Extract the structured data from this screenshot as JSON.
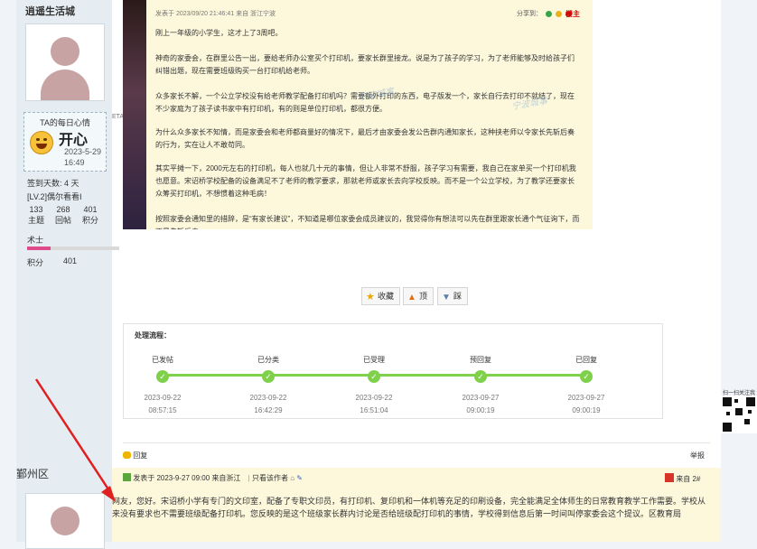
{
  "sidebar": {
    "username": "逍遥生活城",
    "mood_title": "TA的每日心情",
    "mood_text": "开心",
    "mood_date": "2023-5-29",
    "mood_time": "16:49",
    "sign_days": "签到天数: 4 天",
    "level": "[LV.2]偶尔看看I",
    "stats": [
      {
        "value": "133",
        "label": "主题"
      },
      {
        "value": "268",
        "label": "回帖"
      },
      {
        "value": "401",
        "label": "积分"
      }
    ],
    "rank": "术士",
    "points_label": "积分",
    "points_value": "401",
    "side_label": "ETA",
    "area2": "鄞州区"
  },
  "post": {
    "meta": "发表于 2023/09/20 21:46:41 来自 浙江宁波",
    "share": "分享到：",
    "floor": "楼主",
    "paragraphs": [
      "刚上一年级的小学生，这才上了3周吧。",
      "神奇的家委会，在群里公告一出，要给老师办公室买个打印机，要家长群里接龙。说是为了孩子的学习，为了老师能够及时给孩子们纠错出题，现在需要班级购买一台打印机给老师。",
      "众多家长不解，一个公立学校没有给老师教学配备打印机吗？需要额外打印的东西，电子版发一个，家长自行去打印不就结了，现在不少家庭为了孩子读书家中有打印机，有的则是单位打印机，都很方便。",
      "为什么众多家长不知情，而是家委会和老师都商量好的情况下，最后才由家委会发公告群内通知家长，这种挟老师以令家长先斩后奏的行为，实在让人不敢苟同。",
      "其实平摊一下，2000元左右的打印机，每人也就几十元的事情，但让人非常不舒服，孩子学习有需要，我自己在家单买一个打印机我也愿意。宋诏桥学校配备的设备满足不了老师的教学要求，那就老师或家长去向学校反映。而不是一个公立学校，为了教学还要家长众筹买打印机，不想惯着这种毛病！",
      "按照家委会通知里的措辞，是“有家长建议”，不知道是哪位家委会成员建议的，我觉得你有想法可以先在群里跟家长通个气征询下，而不是先斩后奏。"
    ]
  },
  "watermark": "宁波城事",
  "buttons": {
    "favorite": "收藏",
    "up": "顶",
    "down": "踩"
  },
  "flow": {
    "title": "处理流程：",
    "steps": [
      {
        "label": "已发帖",
        "date": "2023-09-22",
        "time": "08:57:15"
      },
      {
        "label": "已分类",
        "date": "2023-09-22",
        "time": "16:42:29"
      },
      {
        "label": "已受理",
        "date": "2023-09-22",
        "time": "16:51:04"
      },
      {
        "label": "预回复",
        "date": "2023-09-27",
        "time": "09:00:19"
      },
      {
        "label": "已回复",
        "date": "2023-09-27",
        "time": "09:00:19"
      }
    ]
  },
  "reply_bar": {
    "reply": "回复",
    "report": "举报"
  },
  "reply_post": {
    "meta": "发表于 2023-9-27 09:00 来自浙江",
    "only_author": "只看该作者",
    "source": "来自",
    "floor": "2#",
    "text": "网友，您好。宋诏桥小学有专门的文印室，配备了专职文印员，有打印机、复印机和一体机等充足的印刷设备，完全能满足全体师生的日常教育教学工作需要。学校从来没有要求也不需要班级配备打印机。您反映的是这个班级家长群内讨论是否给班级配打印机的事情，学校得到信息后第一时间叫停家委会这个提议。区教育局"
  },
  "qr_label": "扫一扫关注我",
  "colors": {
    "accent_green": "#7fd04a",
    "post_bg": "#fdf8dc",
    "sidebar_bg": "#e5edf2",
    "arrow_red": "#e02020"
  }
}
